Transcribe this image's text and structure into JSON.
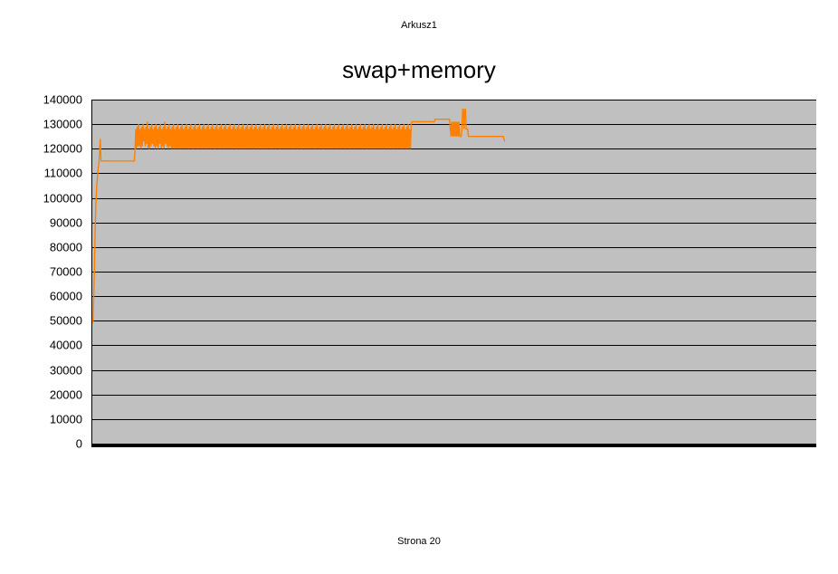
{
  "sheet_name": "Arkusz1",
  "footer": "Strona 20",
  "chart_data": {
    "type": "line",
    "title": "swap+memory",
    "xlabel": "",
    "ylabel": "",
    "ylim": [
      0,
      140000
    ],
    "y_ticks": [
      0,
      10000,
      20000,
      30000,
      40000,
      50000,
      60000,
      70000,
      80000,
      90000,
      100000,
      110000,
      120000,
      130000,
      140000
    ],
    "x_range": [
      0,
      1000
    ],
    "series": [
      {
        "name": "swap+memory",
        "color": "#ff8000",
        "y": [
          49000,
          50000,
          60000,
          72000,
          88000,
          98000,
          104000,
          108000,
          112000,
          114000,
          118000,
          124000,
          115000,
          115000,
          115000,
          115000,
          115000,
          115000,
          115000,
          115000,
          115000,
          115000,
          115000,
          115000,
          115000,
          115000,
          115000,
          115000,
          115000,
          115000,
          115000,
          115000,
          115000,
          115000,
          115000,
          115000,
          115000,
          115000,
          115000,
          115000,
          115000,
          115000,
          115000,
          115000,
          115000,
          115000,
          115000,
          115000,
          115000,
          115000,
          115000,
          115000,
          115000,
          115000,
          115000,
          115000,
          115000,
          115000,
          115000,
          120000,
          128000,
          120000,
          129000,
          121000,
          130000,
          121000,
          128000,
          120000,
          129000,
          121000,
          130000,
          123000,
          128000,
          121000,
          129000,
          122000,
          131000,
          120000,
          128000,
          120000,
          129000,
          121000,
          130000,
          122000,
          128000,
          121000,
          129000,
          120000,
          130000,
          121000,
          128000,
          120000,
          129000,
          122000,
          130000,
          120000,
          128000,
          121000,
          129000,
          120000,
          131000,
          122000,
          128000,
          121000,
          129000,
          120000,
          130000,
          121000,
          128000,
          120000,
          129000,
          120000,
          130000,
          120000,
          128000,
          120000,
          129000,
          120000,
          130000,
          120000,
          128000,
          120000,
          129000,
          120000,
          130000,
          120000,
          128000,
          120000,
          129000,
          120000,
          130000,
          120000,
          128000,
          120000,
          129000,
          120000,
          130000,
          120000,
          128000,
          120000,
          129000,
          120000,
          130000,
          120000,
          128000,
          120000,
          129000,
          120000,
          130000,
          120000,
          128000,
          120000,
          129000,
          120000,
          130000,
          120000,
          128000,
          120000,
          129000,
          120000,
          130000,
          120000,
          128000,
          120000,
          129000,
          120000,
          130000,
          120000,
          128000,
          120000,
          129000,
          120000,
          130000,
          120000,
          128000,
          120000,
          129000,
          120000,
          130000,
          120000,
          128000,
          120000,
          129000,
          120000,
          130000,
          120000,
          128000,
          120000,
          129000,
          120000,
          130000,
          120000,
          128000,
          120000,
          129000,
          120000,
          130000,
          120000,
          128000,
          120000,
          129000,
          120000,
          130000,
          120000,
          128000,
          120000,
          129000,
          120000,
          130000,
          120000,
          128000,
          120000,
          129000,
          120000,
          130000,
          120000,
          128000,
          120000,
          129000,
          120000,
          130000,
          120000,
          128000,
          120000,
          129000,
          120000,
          130000,
          120000,
          128000,
          120000,
          129000,
          120000,
          130000,
          120000,
          128000,
          120000,
          129000,
          120000,
          130000,
          120000,
          128000,
          120000,
          129000,
          120000,
          130000,
          120000,
          128000,
          120000,
          129000,
          120000,
          130000,
          120000,
          128000,
          120000,
          129000,
          120000,
          130000,
          120000,
          128000,
          120000,
          129000,
          120000,
          130000,
          120000,
          128000,
          120000,
          129000,
          120000,
          130000,
          120000,
          128000,
          120000,
          129000,
          120000,
          130000,
          120000,
          128000,
          120000,
          129000,
          120000,
          130000,
          120000,
          128000,
          120000,
          129000,
          120000,
          130000,
          120000,
          128000,
          120000,
          129000,
          120000,
          130000,
          120000,
          128000,
          120000,
          129000,
          120000,
          130000,
          120000,
          128000,
          120000,
          129000,
          120000,
          130000,
          120000,
          128000,
          120000,
          129000,
          120000,
          130000,
          120000,
          128000,
          120000,
          129000,
          120000,
          130000,
          120000,
          128000,
          120000,
          129000,
          120000,
          130000,
          120000,
          128000,
          120000,
          129000,
          120000,
          130000,
          120000,
          128000,
          120000,
          129000,
          120000,
          130000,
          120000,
          128000,
          120000,
          129000,
          120000,
          130000,
          120000,
          128000,
          120000,
          129000,
          120000,
          130000,
          120000,
          128000,
          120000,
          129000,
          120000,
          130000,
          120000,
          128000,
          120000,
          129000,
          120000,
          130000,
          120000,
          128000,
          120000,
          129000,
          120000,
          130000,
          120000,
          128000,
          120000,
          129000,
          120000,
          130000,
          120000,
          128000,
          120000,
          129000,
          120000,
          130000,
          120000,
          128000,
          120000,
          129000,
          120000,
          130000,
          120000,
          128000,
          120000,
          129000,
          120000,
          130000,
          120000,
          128000,
          120000,
          129000,
          120000,
          130000,
          120000,
          128000,
          120000,
          129000,
          120000,
          130000,
          120000,
          128000,
          120000,
          129000,
          120000,
          130000,
          120000,
          128000,
          120000,
          129000,
          120000,
          130000,
          120000,
          128000,
          120000,
          129000,
          120000,
          130000,
          120000,
          128000,
          120000,
          129000,
          120000,
          130000,
          120000,
          128000,
          120000,
          129000,
          120000,
          130000,
          120000,
          128000,
          120000,
          129000,
          120000,
          130000,
          120000,
          128000,
          120000,
          130000,
          131000,
          131000,
          131000,
          131000,
          131000,
          131000,
          131000,
          131000,
          131000,
          131000,
          131000,
          131000,
          131000,
          131000,
          131000,
          131000,
          131000,
          131000,
          131000,
          131000,
          131000,
          131000,
          131000,
          131000,
          131000,
          131000,
          131000,
          131000,
          131000,
          131000,
          131000,
          131000,
          132000,
          132000,
          132000,
          132000,
          132000,
          132000,
          132000,
          132000,
          132000,
          132000,
          132000,
          132000,
          132000,
          132000,
          132000,
          132000,
          132000,
          132000,
          132000,
          132000,
          132000,
          128000,
          125000,
          131000,
          125000,
          131000,
          125000,
          131000,
          125000,
          131000,
          125000,
          131000,
          125000,
          131000,
          125000,
          125000,
          125000,
          128000,
          136000,
          136000,
          128000,
          136000,
          136000,
          128000,
          128000,
          128000,
          125000,
          125000,
          125000,
          125000,
          125000,
          125000,
          125000,
          125000,
          125000,
          125000,
          125000,
          125000,
          125000,
          125000,
          125000,
          125000,
          125000,
          125000,
          125000,
          125000,
          125000,
          125000,
          125000,
          125000,
          125000,
          125000,
          125000,
          125000,
          125000,
          125000,
          125000,
          125000,
          125000,
          125000,
          125000,
          125000,
          125000,
          125000,
          125000,
          125000,
          125000,
          125000,
          125000,
          125000,
          125000,
          125000,
          125000,
          125000,
          125000,
          124000,
          123000
        ]
      }
    ]
  }
}
